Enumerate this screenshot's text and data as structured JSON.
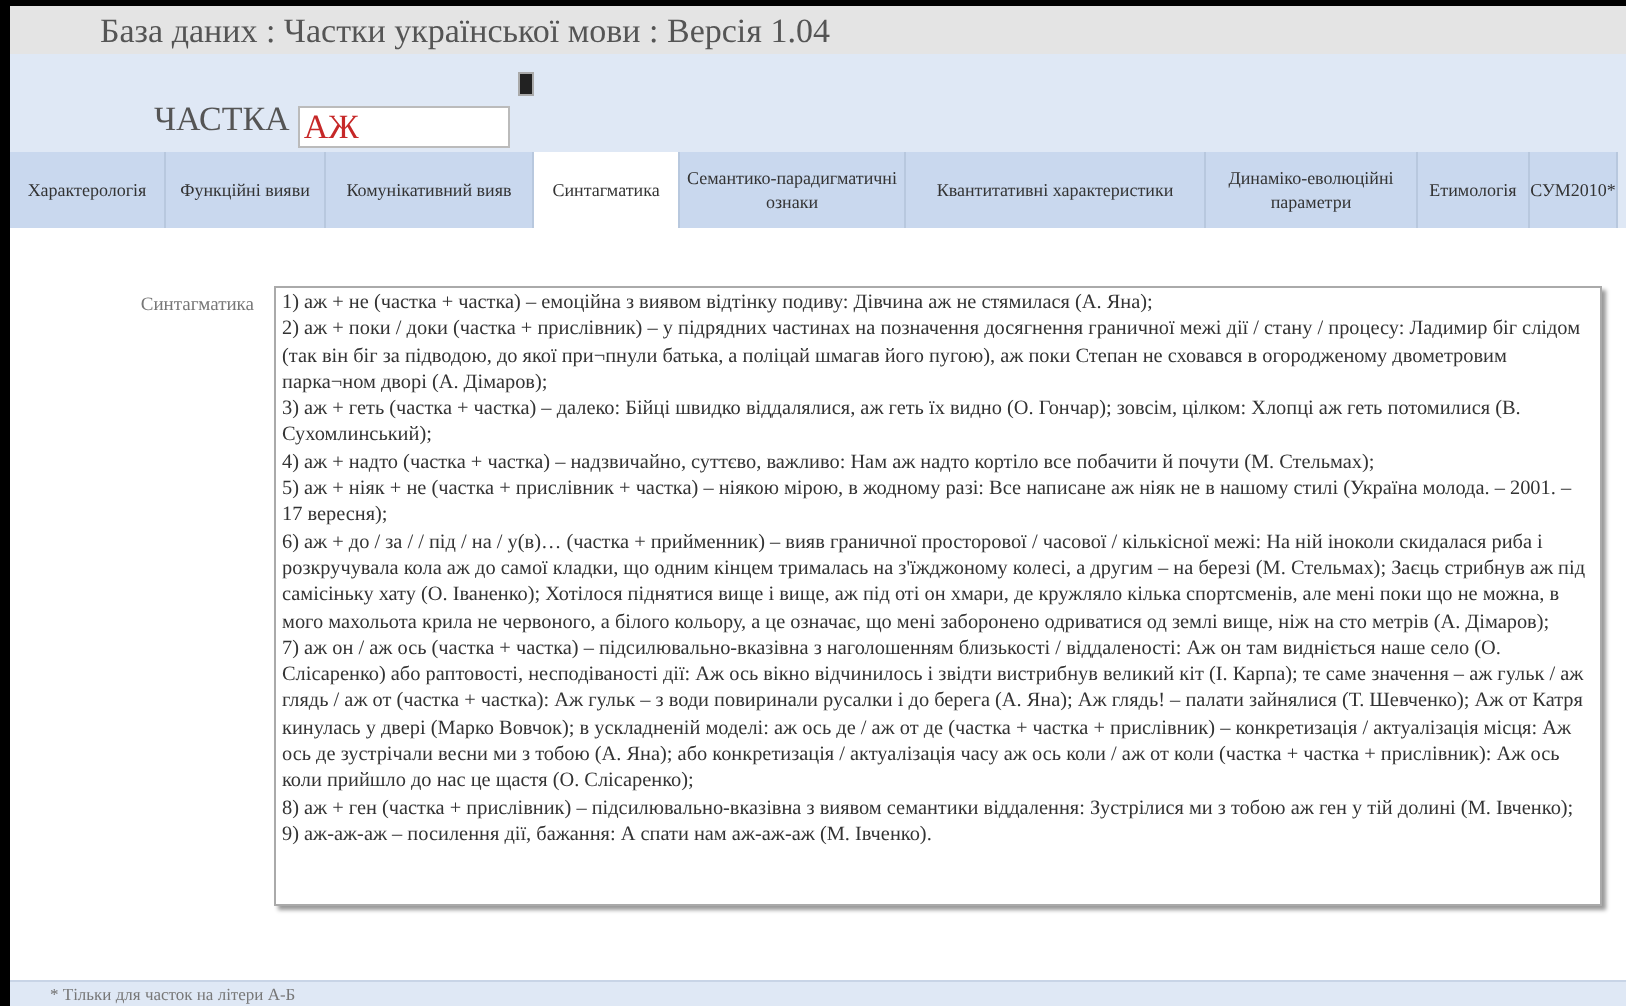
{
  "window": {
    "title": "База даних : Частки української мови : Версія 1.04"
  },
  "particle": {
    "label": "ЧАСТКА",
    "value": "АЖ"
  },
  "tabs": [
    {
      "label": "Характерологія",
      "selected": false
    },
    {
      "label": "Функційні вияви",
      "selected": false
    },
    {
      "label": "Комунікативний вияв",
      "selected": false
    },
    {
      "label": "Синтагматика",
      "selected": true
    },
    {
      "label": "Семантико-парадигматичні ознаки",
      "selected": false
    },
    {
      "label": "Квантитативні характеристики",
      "selected": false
    },
    {
      "label": "Динаміко-еволюційні параметри",
      "selected": false
    },
    {
      "label": "Етимологія",
      "selected": false
    },
    {
      "label": "СУМ2010*",
      "selected": false
    }
  ],
  "field": {
    "label": "Синтагматика",
    "items": [
      "1) аж + не (частка + частка) –  емоційна з виявом відтінку подиву: Дівчина аж не стямилася (А. Яна);",
      "2) аж + поки / доки (частка + прислівник) – у підрядних частинах на позначення досягнення граничної межі дії / стану / процесу: Ладимир біг слідом (так він біг за підводою, до якої при¬пнули батька,  а поліцай шмагав його пугою),  аж  поки Степан не сховався в огородженому двометровим  парка¬ном дворі (А. Дімаров);",
      "3) аж + геть (частка + частка) – далеко: Бійці швидко віддалялися, аж геть їх видно (О. Гончар);  зовсім, цілком: Хлопці аж геть потомилися (В. Сухомлинський);",
      "4) аж + надто (частка + частка) – надзвичайно, суттєво, важливо:  Нам аж надто кортіло все побачити й почути (М. Стельмах);",
      "5) аж + ніяк + не (частка + прислівник + частка) – ніякою мірою, в жодному разі: Все написане аж ніяк не в нашому стилі (Україна молода. – 2001. – 17 вересня);",
      "6) аж + до / за / / під / на / у(в)… (частка + прийменник) – вияв граничної просторової / часової / кількісної межі: На ній іноколи скидалася риба і розкручувала кола аж до самої кладки, що одним кінцем трималась на з'їжджоному колесі, а другим – на березі (М. Стельмах);  Заєць стрибнув аж під самісіньку хату (О. Іваненко); Хотілося піднятися вище і вище, аж під оті он хмари, де кружляло кілька спортсменів, але мені поки що не можна, в мого махольота крила не червоного, а білого кольору, а це означає, що мені заборонено одриватися од землі вище, ніж на сто метрів (А. Дімаров);",
      "7) аж он / аж ось (частка + частка) – підсилювально-вказівна з наголошенням близькості / віддаленості: Аж он там видніється наше село (О. Слісаренко) або раптовості, несподіваності дії: Аж ось вікно відчинилось і звідти вистрибнув великий кіт (І. Карпа); те саме значення – аж гульк / аж глядь / аж от (частка + частка): Аж гульк – з води повиринали русалки і до берега (А. Яна); Аж глядь! – палати зайнялися (Т. Шевченко); Аж от Катря кинулась у двері (Марко Вовчок); в ускладненій моделі: аж ось де / аж от де (частка + частка + прислівник) – конкретизація / актуалізація місця: Аж ось де зустрічали весни ми з тобою (А. Яна); або конкретизація / актуалізація часу аж ось коли / аж от коли (частка + частка + прислівник):  Аж ось коли прийшло до нас це щастя (О. Слісаренко);",
      "8) аж + ген (частка + прислівник) – підсилювально-вказівна з виявом семантики віддалення: Зустрілися ми з тобою аж ген у тій долині (М. Івченко);",
      "9) аж-аж-аж – посилення дії, бажання: А спати нам аж-аж-аж (М. Івченко)."
    ]
  },
  "footer": {
    "note": "* Тільки для часток на літери А-Б"
  }
}
